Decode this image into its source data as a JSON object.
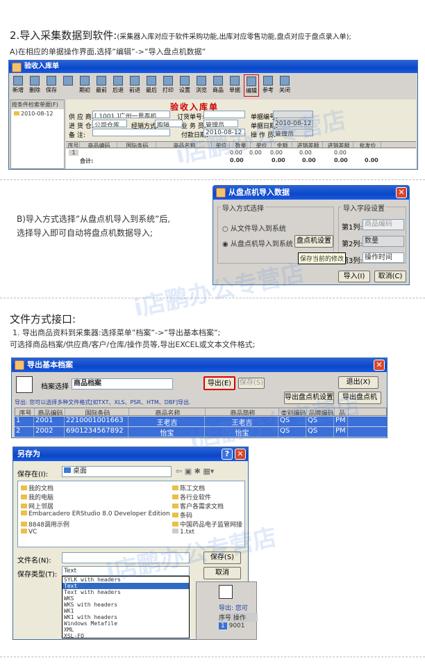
{
  "section1": {
    "title": "2.导入采集数据到软件:",
    "title_note": "(采集器入库对应于软件采购功能,出库对应零售功能,盘点对应于盘点录入单);",
    "stepA": "A)在相应的单据操作界面,选择”编辑”->”导入盘点机数据”"
  },
  "receipt": {
    "window_title": "验收入库单",
    "doc_title": "验收入库单",
    "toolbar": [
      "新增",
      "删除",
      "保存",
      "",
      "期初",
      "最前",
      "后退",
      "前进",
      "最后",
      "打印",
      "设置",
      "浏览",
      "商品",
      "单据",
      "编辑",
      "参考",
      "关闭"
    ],
    "tree_header": "按条件检索单据(F)",
    "tree_item": "2010-08-12",
    "fields": {
      "supplier_label": "供 应 商:",
      "supplier": "[ 1001 ]广州一恩泰机",
      "warehouse_label": "进 货 仓:",
      "warehouse": "公司仓库",
      "note_label": "备    注:",
      "order_label": "订货单号:",
      "method_label": "经销方式:",
      "method": "购销",
      "clerk_label": "业 务 员:",
      "clerk": "管理员",
      "paydate_label": "付款日期:",
      "paydate": "2010-08-12",
      "docno_label": "单据编号:",
      "docdate_label": "单据日期:",
      "docdate": "2010-08-12",
      "operator_label": "操 作 员:",
      "operator": "管理员"
    },
    "columns": [
      "序号",
      "商品编码",
      "国际条码",
      "商品名称",
      "单位",
      "数量",
      "单价",
      "金额",
      "进销差额",
      "进销差额",
      "批发价"
    ],
    "row1": [
      "1",
      "0.00",
      "0.00",
      "0.00",
      "0.00",
      "0.00"
    ],
    "total_label": "合计:",
    "totals": [
      "0.00",
      "0.00",
      "0.00",
      "0.00",
      "0.00"
    ]
  },
  "stepB": {
    "line1": "B)导入方式选择”从盘点机导入到系统”后,",
    "line2": "选择导入即可自动将盘点机数据导入;"
  },
  "importDialog": {
    "title": "从盘点机导入数据",
    "method_group": "导入方式选择",
    "opt_file": "从文件导入到系统",
    "opt_device": "从盘点机导入到系统",
    "device_btn": "盘点机设置",
    "fields_group": "导入字段设置",
    "col1_label": "第1列:",
    "col1": "商品编码",
    "col2_label": "第2列:",
    "col2": "数量",
    "col3_label": "第3列:",
    "col3": "操作时间",
    "tooltip": "保存当前的修改",
    "import_btn": "导入(I)",
    "cancel_btn": "取消(C)"
  },
  "section2": {
    "title": "文件方式接口:",
    "line1": "1.   导出商品资料到采集器:选择菜单”档案”->”导出基本档案”;",
    "line2": "可选择商品档案/供应商/客户/仓库/操作员等,导出EXCEL或文本文件格式;"
  },
  "exportWin": {
    "title": "导出基本档案",
    "archive_label": "档案选择",
    "archive": "商品档案",
    "export_btn": "导出(E)",
    "save_btn": "保存(S)",
    "exit_btn": "退出(X)",
    "device_set_btn": "导出盘点机设置",
    "device_export_btn": "导出盘点机",
    "hint": "导出: 您可以选择多种文件格式[如TXT、XLS、PSR、HTM、DBF]导出.",
    "columns": [
      "序号",
      "商品编码",
      "国际条码",
      "商品名称",
      "商品简称",
      "类别编码",
      "品牌编码",
      "品"
    ],
    "rows": [
      [
        "1",
        "2001",
        "2210001001663",
        "王老吉",
        "王老吉",
        "QS",
        "QS",
        "PM"
      ],
      [
        "2",
        "2002",
        "6901234567892",
        "怡宝",
        "怡宝",
        "QS",
        "QS",
        "PM"
      ]
    ]
  },
  "saveAs": {
    "title": "另存为",
    "savein_label": "保存在(I):",
    "savein": "桌面",
    "left_items": [
      "我的文档",
      "我的电脑",
      "网上邻居",
      "Embarcadero ERStudio 8.0 Developer Edition",
      "8848调用示例",
      "VC"
    ],
    "right_items": [
      "陈工文档",
      "各行业软件",
      "客户各需求文档",
      "条码",
      "中国药品电子监管网接",
      "1.txt"
    ],
    "filename_label": "文件名(N):",
    "filetype_label": "保存类型(T):",
    "filetype": "Text",
    "save_btn": "保存(S)",
    "cancel_btn": "取消",
    "types": [
      "SYLK with headers",
      "Text",
      "Text with headers",
      "WKS",
      "WKS with headers",
      "WK1",
      "WK1 with headers",
      "Windows Metafile",
      "XML",
      "XSL-FO"
    ],
    "behind_hint": "导出: 您可",
    "behind_cols": [
      "序号",
      "操作"
    ],
    "behind_row": [
      "1",
      "9001"
    ]
  },
  "watermark": "i店鹏办公专营店"
}
